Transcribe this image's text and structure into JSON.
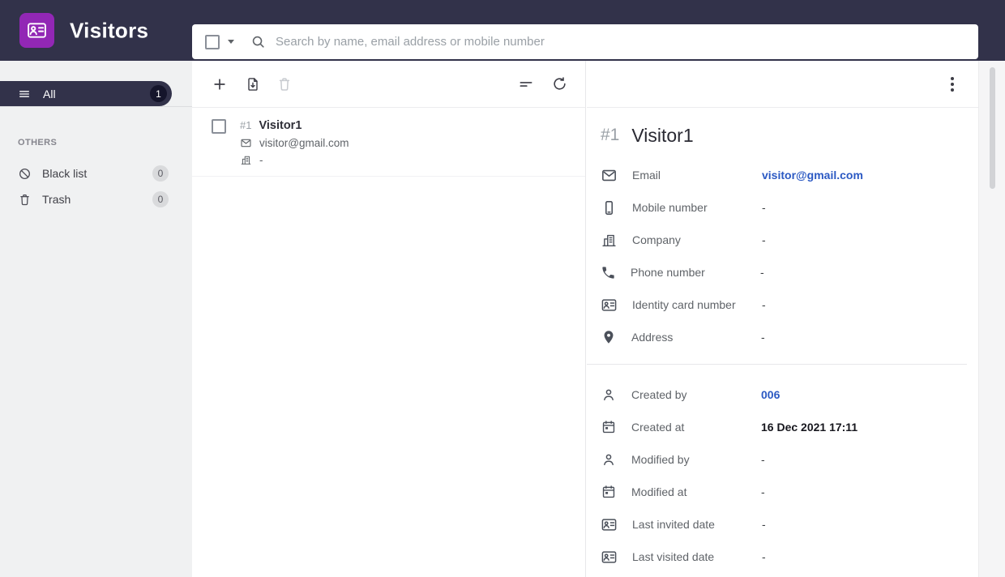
{
  "app": {
    "title": "Visitors"
  },
  "header": {
    "search_placeholder": "Search by name, email address or mobile number"
  },
  "sidebar": {
    "all_label": "All",
    "all_count": "1",
    "section_label": "OTHERS",
    "items": [
      {
        "label": "Black list",
        "count": "0",
        "icon": "block-icon"
      },
      {
        "label": "Trash",
        "count": "0",
        "icon": "trash-icon"
      }
    ]
  },
  "list": {
    "row": {
      "index_label": "#1",
      "name": "Visitor1",
      "email": "visitor@gmail.com",
      "company": "-"
    }
  },
  "detail": {
    "index_label": "#1",
    "name": "Visitor1",
    "fields": [
      {
        "label": "Email",
        "value": "visitor@gmail.com",
        "icon": "email-icon",
        "style": "link"
      },
      {
        "label": "Mobile number",
        "value": "-",
        "icon": "mobile-icon",
        "style": "plain"
      },
      {
        "label": "Company",
        "value": "-",
        "icon": "company-icon",
        "style": "plain"
      },
      {
        "label": "Phone number",
        "value": "-",
        "icon": "phone-icon",
        "style": "plain"
      },
      {
        "label": "Identity card number",
        "value": "-",
        "icon": "id-card-icon",
        "style": "plain"
      },
      {
        "label": "Address",
        "value": "-",
        "icon": "location-icon",
        "style": "plain"
      }
    ],
    "meta": [
      {
        "label": "Created by",
        "value": "006",
        "icon": "person-icon",
        "style": "link"
      },
      {
        "label": "Created at",
        "value": "16 Dec 2021 17:11",
        "icon": "calendar-icon",
        "style": "strong"
      },
      {
        "label": "Modified by",
        "value": "-",
        "icon": "person-icon",
        "style": "plain"
      },
      {
        "label": "Modified at",
        "value": "-",
        "icon": "calendar-icon",
        "style": "plain"
      },
      {
        "label": "Last invited date",
        "value": "-",
        "icon": "id-card-icon",
        "style": "plain"
      },
      {
        "label": "Last visited date",
        "value": "-",
        "icon": "id-card-icon",
        "style": "plain"
      }
    ]
  },
  "icons": {
    "badge-icon": "contact-card",
    "menu-icon": "three-lines",
    "block-icon": "circle-slash",
    "trash-icon": "trash-can",
    "plus-icon": "+",
    "import-icon": "document-arrow-down",
    "sort-icon": "two-lines",
    "refresh-icon": "circular-arrow",
    "search-icon": "magnifier",
    "email-icon": "envelope",
    "company-icon": "building",
    "mobile-icon": "smartphone",
    "phone-icon": "handset",
    "id-card-icon": "contact-card",
    "location-icon": "map-pin",
    "person-icon": "person",
    "calendar-icon": "calendar",
    "kebab-icon": "vertical-dots",
    "checkbox": "empty-square",
    "caret-down-icon": "triangle-down"
  },
  "colors": {
    "header": "#32324a",
    "brand": "#9227b5",
    "link": "#2b59c3",
    "sidebar_bg": "#f0f1f2"
  }
}
